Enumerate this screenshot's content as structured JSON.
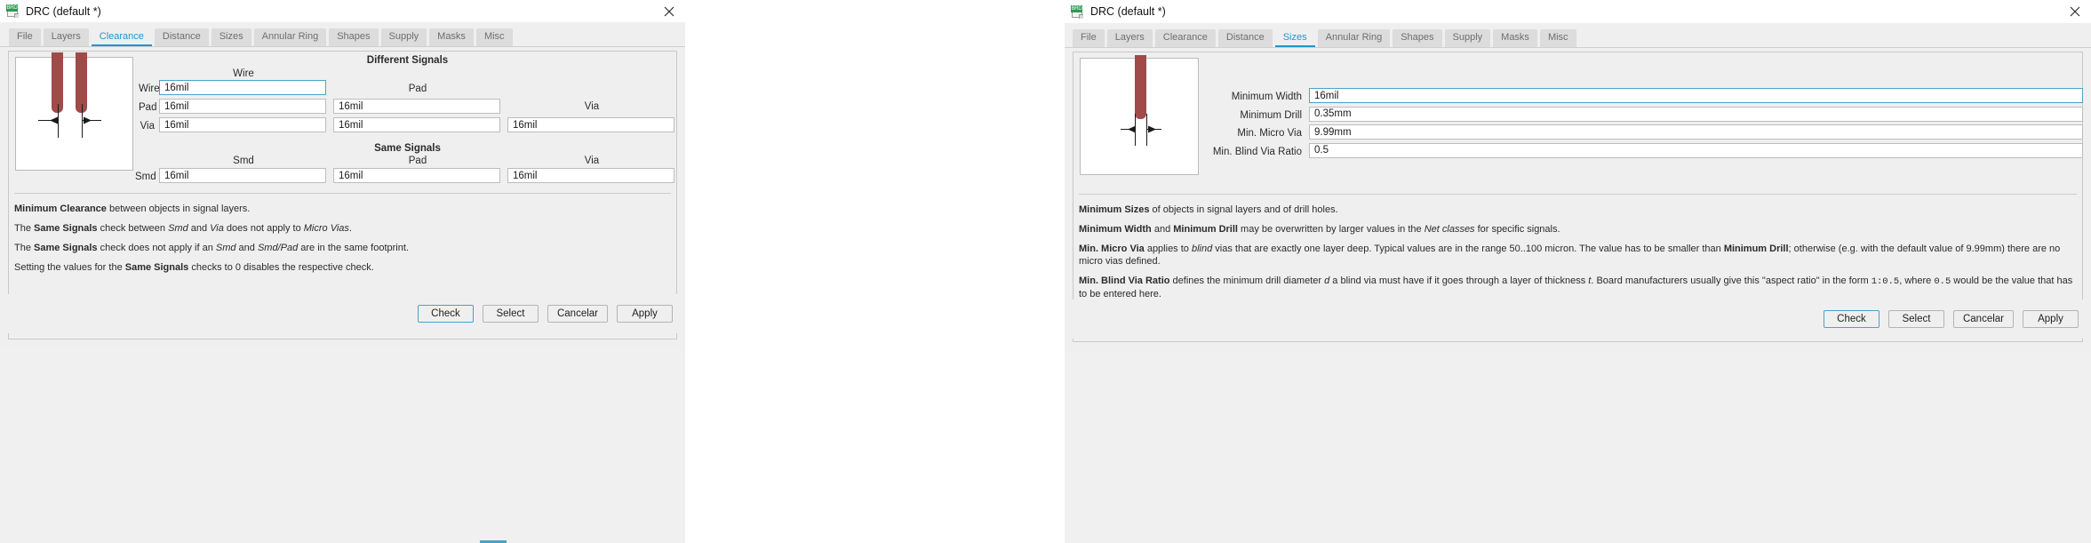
{
  "left_window": {
    "title": "DRC (default *)",
    "icon": "board-file-icon",
    "close_icon": "close-icon",
    "tabs": [
      {
        "label": "File",
        "selected": false
      },
      {
        "label": "Layers",
        "selected": false
      },
      {
        "label": "Clearance",
        "selected": true
      },
      {
        "label": "Distance",
        "selected": false
      },
      {
        "label": "Sizes",
        "selected": false
      },
      {
        "label": "Annular Ring",
        "selected": false
      },
      {
        "label": "Shapes",
        "selected": false
      },
      {
        "label": "Supply",
        "selected": false
      },
      {
        "label": "Masks",
        "selected": false
      },
      {
        "label": "Misc",
        "selected": false
      }
    ],
    "preview_alt": "clearance-preview",
    "different_signals": {
      "group_title": "Different Signals",
      "col_headers": [
        "Wire",
        "Pad",
        "Via"
      ],
      "rows": [
        {
          "label": "Wire",
          "values": [
            "16mil"
          ]
        },
        {
          "label": "Pad",
          "values": [
            "16mil",
            "16mil"
          ]
        },
        {
          "label": "Via",
          "values": [
            "16mil",
            "16mil",
            "16mil"
          ]
        }
      ]
    },
    "same_signals": {
      "group_title": "Same Signals",
      "col_headers": [
        "Smd",
        "Pad",
        "Via"
      ],
      "rows": [
        {
          "label": "Smd",
          "values": [
            "16mil",
            "16mil",
            "16mil"
          ]
        }
      ]
    },
    "description": [
      {
        "id": "d1",
        "parts": [
          {
            "t": "Minimum Clearance",
            "s": "b"
          },
          {
            "t": " between objects in signal layers.",
            "s": ""
          }
        ]
      },
      {
        "id": "d2",
        "parts": [
          {
            "t": "The ",
            "s": ""
          },
          {
            "t": "Same Signals",
            "s": "b"
          },
          {
            "t": " check between ",
            "s": ""
          },
          {
            "t": "Smd",
            "s": "i"
          },
          {
            "t": " and ",
            "s": ""
          },
          {
            "t": "Via",
            "s": "i"
          },
          {
            "t": " does not apply to ",
            "s": ""
          },
          {
            "t": "Micro Vias",
            "s": "i"
          },
          {
            "t": ".",
            "s": ""
          }
        ]
      },
      {
        "id": "d3",
        "parts": [
          {
            "t": "The ",
            "s": ""
          },
          {
            "t": "Same Signals",
            "s": "b"
          },
          {
            "t": " check does not apply if an ",
            "s": ""
          },
          {
            "t": "Smd",
            "s": "i"
          },
          {
            "t": " and ",
            "s": ""
          },
          {
            "t": "Smd/Pad",
            "s": "i"
          },
          {
            "t": " are in the same footprint.",
            "s": ""
          }
        ]
      },
      {
        "id": "d4",
        "parts": [
          {
            "t": "Setting the values for the ",
            "s": ""
          },
          {
            "t": "Same Signals",
            "s": "b"
          },
          {
            "t": " checks to 0 disables the respective check.",
            "s": ""
          }
        ]
      }
    ],
    "buttons": [
      {
        "label": "Check",
        "default": true
      },
      {
        "label": "Select",
        "default": false
      },
      {
        "label": "Cancelar",
        "default": false
      },
      {
        "label": "Apply",
        "default": false
      }
    ]
  },
  "right_window": {
    "title": "DRC (default *)",
    "icon": "board-file-icon",
    "close_icon": "close-icon",
    "tabs": [
      {
        "label": "File",
        "selected": false
      },
      {
        "label": "Layers",
        "selected": false
      },
      {
        "label": "Clearance",
        "selected": false
      },
      {
        "label": "Distance",
        "selected": false
      },
      {
        "label": "Sizes",
        "selected": true
      },
      {
        "label": "Annular Ring",
        "selected": false
      },
      {
        "label": "Shapes",
        "selected": false
      },
      {
        "label": "Supply",
        "selected": false
      },
      {
        "label": "Masks",
        "selected": false
      },
      {
        "label": "Misc",
        "selected": false
      }
    ],
    "preview_alt": "sizes-preview",
    "fields": [
      {
        "label": "Minimum Width",
        "value": "16mil",
        "focused": true
      },
      {
        "label": "Minimum Drill",
        "value": "0.35mm",
        "focused": false
      },
      {
        "label": "Min. Micro Via",
        "value": "9.99mm",
        "focused": false
      },
      {
        "label": "Min. Blind Via Ratio",
        "value": "0.5",
        "focused": false
      }
    ],
    "description": [
      {
        "id": "r1",
        "parts": [
          {
            "t": "Minimum Sizes",
            "s": "b"
          },
          {
            "t": " of objects in signal layers and of drill holes.",
            "s": ""
          }
        ]
      },
      {
        "id": "r2",
        "parts": [
          {
            "t": "Minimum Width",
            "s": "b"
          },
          {
            "t": " and ",
            "s": ""
          },
          {
            "t": "Minimum Drill",
            "s": "b"
          },
          {
            "t": " may be overwritten by larger values in the ",
            "s": ""
          },
          {
            "t": "Net classes",
            "s": "i"
          },
          {
            "t": " for specific signals.",
            "s": ""
          }
        ]
      },
      {
        "id": "r3",
        "parts": [
          {
            "t": "Min. Micro Via",
            "s": "b"
          },
          {
            "t": " applies to ",
            "s": ""
          },
          {
            "t": "blind",
            "s": "i"
          },
          {
            "t": " vias that are exactly one layer deep. Typical values are in the range 50..100 micron. The value has to be smaller than ",
            "s": ""
          },
          {
            "t": "Minimum Drill",
            "s": "b"
          },
          {
            "t": "; otherwise (e.g. with the default value of 9.99mm) there are no micro vias defined.",
            "s": ""
          }
        ]
      },
      {
        "id": "r4",
        "parts": [
          {
            "t": "Min. Blind Via Ratio",
            "s": "b"
          },
          {
            "t": " defines the minimum drill diameter ",
            "s": ""
          },
          {
            "t": "d",
            "s": "i"
          },
          {
            "t": " a blind via must have if it goes through a layer of thickness ",
            "s": ""
          },
          {
            "t": "t",
            "s": "i"
          },
          {
            "t": ". Board manufacturers usually give this \"aspect ratio\" in the form ",
            "s": ""
          },
          {
            "t": "1:0.5",
            "s": "c"
          },
          {
            "t": ", where ",
            "s": ""
          },
          {
            "t": "0.5",
            "s": "c"
          },
          {
            "t": " would be the value that has to be entered here.",
            "s": ""
          }
        ]
      }
    ],
    "buttons": [
      {
        "label": "Check",
        "default": true
      },
      {
        "label": "Select",
        "default": false
      },
      {
        "label": "Cancelar",
        "default": false
      },
      {
        "label": "Apply",
        "default": false
      }
    ]
  },
  "colors": {
    "accent": "#2196cf",
    "pad": "#a04a4a",
    "panel_bg": "#efefef",
    "tab_bg": "#dcdcdc"
  }
}
